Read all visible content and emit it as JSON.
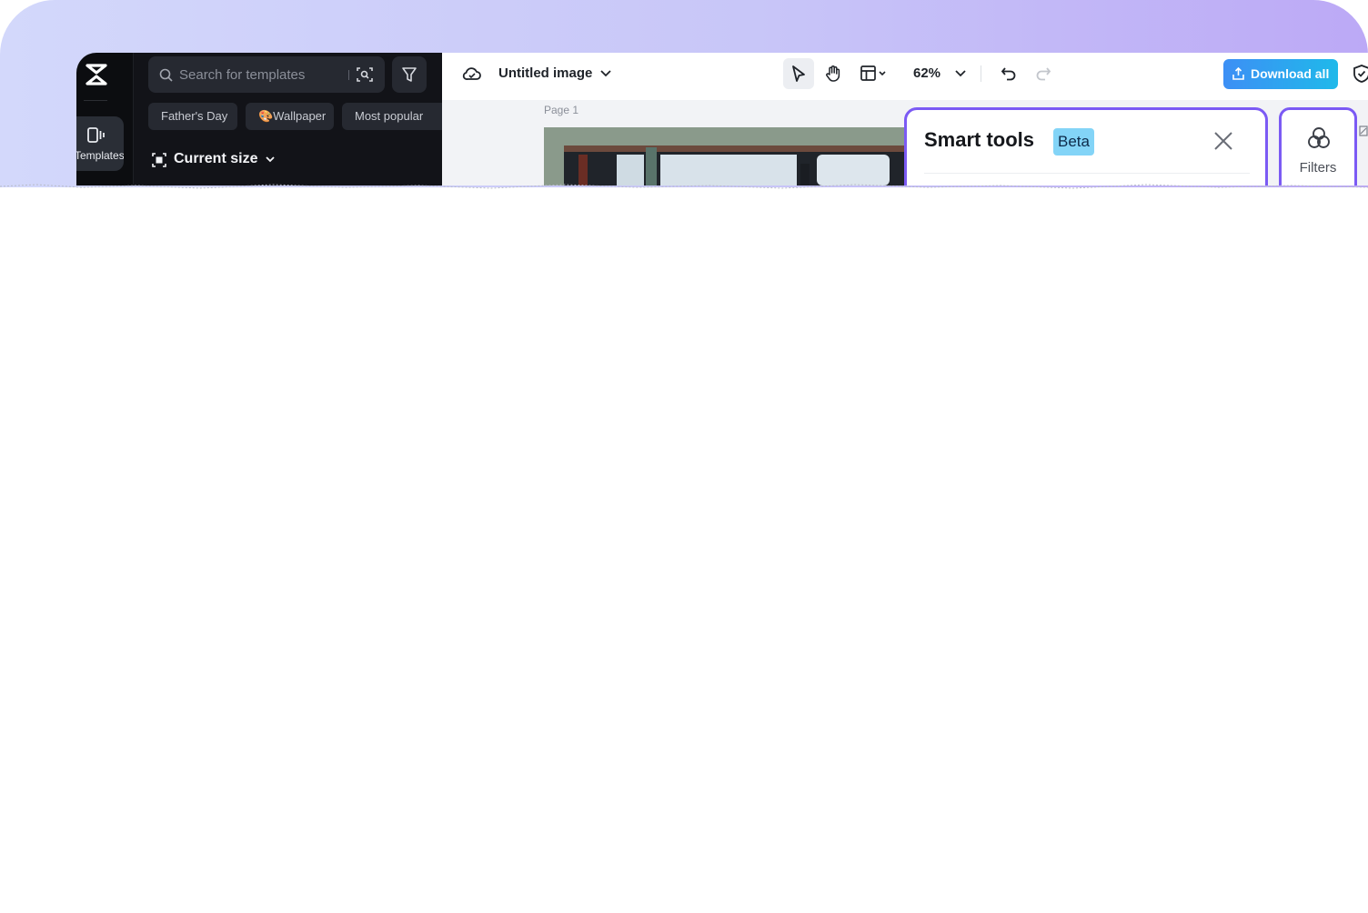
{
  "rail": {
    "templates_label": "Templates"
  },
  "search": {
    "placeholder": "Search for templates"
  },
  "chips": [
    {
      "label": "Father's Day"
    },
    {
      "label": "🎨Wallpaper"
    },
    {
      "label": "Most popular"
    }
  ],
  "size_selector": {
    "label": "Current size"
  },
  "header": {
    "title": "Untitled image",
    "zoom": "62%",
    "download_label": "Download all"
  },
  "canvas": {
    "page_label": "Page 1"
  },
  "smart_tools": {
    "title": "Smart tools",
    "badge": "Beta"
  },
  "filters": {
    "label": "Filters"
  },
  "colors": {
    "accent_purple": "#7b5af4",
    "download_gradient_start": "#3d8ff5",
    "download_gradient_end": "#1fb9ea",
    "beta_badge": "#83d4f7",
    "sidebar_bg": "#121318"
  },
  "icons": [
    "logo-icon",
    "templates-icon",
    "search-icon",
    "image-search-icon",
    "filter-icon",
    "frame-icon",
    "cloud-icon",
    "chevron-down-icon",
    "select-cursor-icon",
    "hand-icon",
    "layout-icon",
    "undo-icon",
    "redo-icon",
    "upload-icon",
    "shield-icon",
    "close-icon",
    "filters-icon"
  ]
}
